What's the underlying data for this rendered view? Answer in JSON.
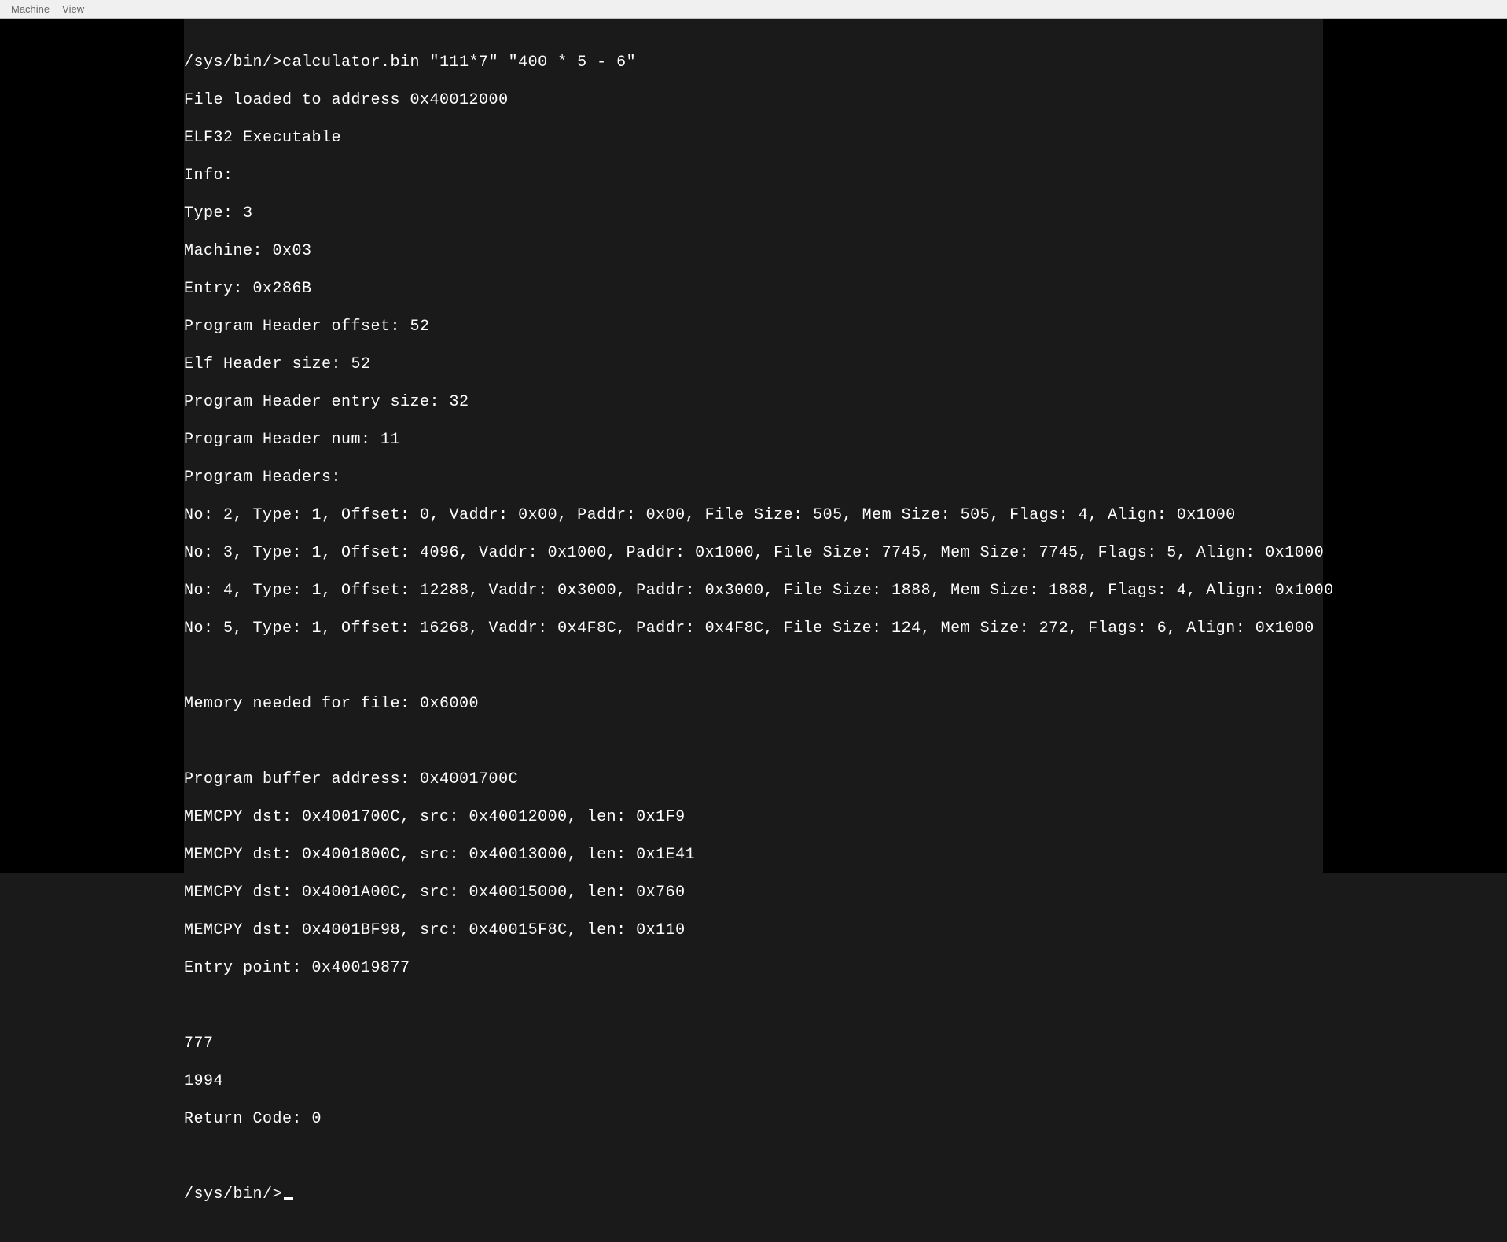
{
  "menubar": {
    "items": [
      {
        "label": "Machine"
      },
      {
        "label": "View"
      }
    ]
  },
  "terminal": {
    "prompt_path": "/sys/bin/>",
    "cmd": "calculator.bin \"111*7\" \"400 * 5 - 6\"",
    "lines": [
      "File loaded to address 0x40012000",
      "ELF32 Executable",
      "Info:",
      "Type: 3",
      "Machine: 0x03",
      "Entry: 0x286B",
      "Program Header offset: 52",
      "Elf Header size: 52",
      "Program Header entry size: 32",
      "Program Header num: 11",
      "Program Headers:",
      "No: 2, Type: 1, Offset: 0, Vaddr: 0x00, Paddr: 0x00, File Size: 505, Mem Size: 505, Flags: 4, Align: 0x1000",
      "No: 3, Type: 1, Offset: 4096, Vaddr: 0x1000, Paddr: 0x1000, File Size: 7745, Mem Size: 7745, Flags: 5, Align: 0x1000",
      "No: 4, Type: 1, Offset: 12288, Vaddr: 0x3000, Paddr: 0x3000, File Size: 1888, Mem Size: 1888, Flags: 4, Align: 0x1000",
      "No: 5, Type: 1, Offset: 16268, Vaddr: 0x4F8C, Paddr: 0x4F8C, File Size: 124, Mem Size: 272, Flags: 6, Align: 0x1000",
      "",
      "Memory needed for file: 0x6000",
      "",
      "Program buffer address: 0x4001700C",
      "MEMCPY dst: 0x4001700C, src: 0x40012000, len: 0x1F9",
      "MEMCPY dst: 0x4001800C, src: 0x40013000, len: 0x1E41",
      "MEMCPY dst: 0x4001A00C, src: 0x40015000, len: 0x760",
      "MEMCPY dst: 0x4001BF98, src: 0x40015F8C, len: 0x110",
      "Entry point: 0x40019877",
      "",
      "777",
      "1994",
      "Return Code: 0",
      ""
    ],
    "prompt_final": "/sys/bin/>"
  }
}
